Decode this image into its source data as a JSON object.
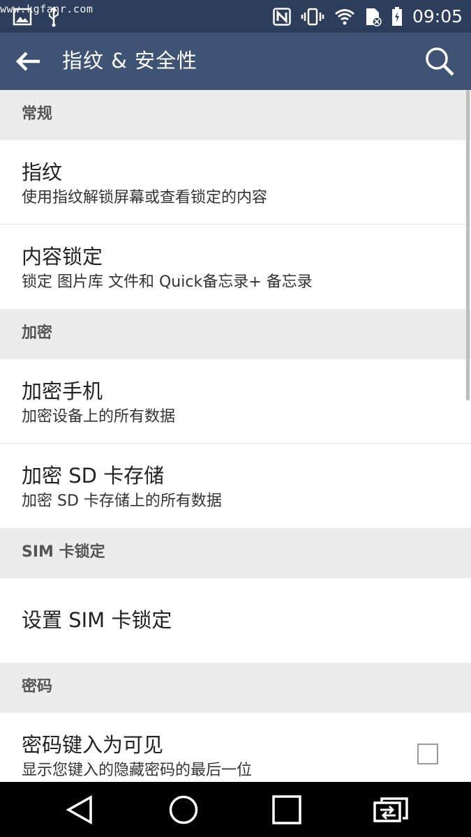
{
  "status_bar": {
    "watermark": "www.kgfanr.com",
    "time": "09:05",
    "icons": [
      "image-icon",
      "usb-icon",
      "nfc-icon",
      "vibrate-icon",
      "wifi-icon",
      "sd-card-icon",
      "battery-icon"
    ]
  },
  "app_bar": {
    "title": "指纹 & 安全性",
    "back_icon": "arrow-left-icon",
    "search_icon": "search-icon"
  },
  "sections": [
    {
      "header": "常规",
      "items": [
        {
          "title": "指纹",
          "subtitle": "使用指纹解锁屏幕或查看锁定的内容"
        },
        {
          "title": "内容锁定",
          "subtitle": "锁定 图片库 文件和 Quick备忘录+ 备忘录"
        }
      ]
    },
    {
      "header": "加密",
      "items": [
        {
          "title": "加密手机",
          "subtitle": "加密设备上的所有数据"
        },
        {
          "title": "加密 SD 卡存储",
          "subtitle": "加密 SD 卡存储上的所有数据"
        }
      ]
    },
    {
      "header": "SIM 卡锁定",
      "items": [
        {
          "title": "设置 SIM 卡锁定"
        }
      ]
    },
    {
      "header": "密码",
      "items": [
        {
          "title": "密码键入为可见",
          "subtitle": "显示您键入的隐藏密码的最后一位",
          "checked": false
        }
      ]
    }
  ],
  "nav_bar": {
    "icons": [
      "back-triangle-icon",
      "home-circle-icon",
      "recents-square-icon",
      "dual-window-icon"
    ]
  },
  "colors": {
    "status_bar": "#2c3e5c",
    "app_bar": "#3f5374",
    "section_header_bg": "#ececec",
    "nav_bar": "#000000"
  }
}
